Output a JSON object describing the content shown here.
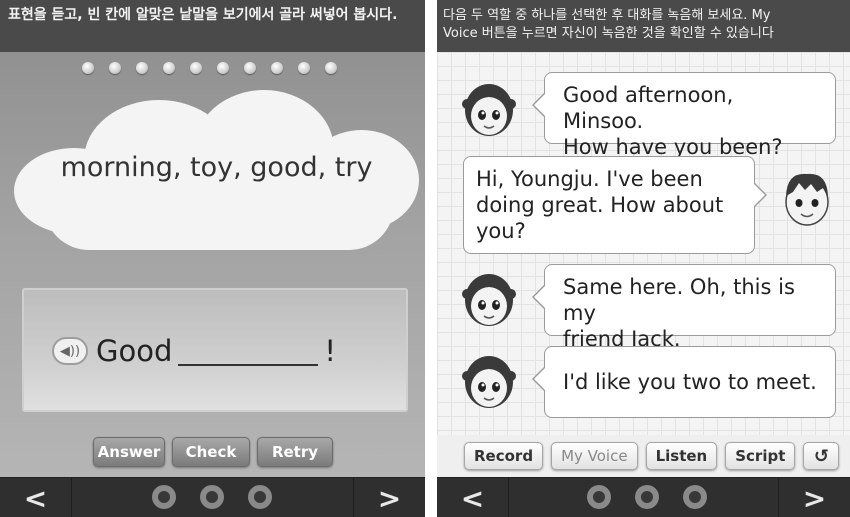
{
  "left": {
    "instruction": "표현을 듣고, 빈 칸에 알맞은 낱말을 보기에서 골라 써넣어 봅시다.",
    "progress_dots": 10,
    "word_bank": "morning, toy, good, try",
    "sentence": {
      "before": "Good",
      "after": "!"
    },
    "buttons": {
      "answer": "Answer",
      "check": "Check",
      "retry": "Retry"
    },
    "nav": {
      "prev": "<",
      "next": ">"
    }
  },
  "right": {
    "instruction_line1": "다음 두 역할 중 하나를 선택한 후 대화를 녹음해 보세요. My",
    "instruction_line2": "Voice 버튼을 누르면 자신이 녹음한 것을 확인할 수 있습니다",
    "dialog": [
      {
        "speaker": "girl",
        "line1": "Good afternoon, Minsoo.",
        "line2": "How have you been?",
        "line3": ""
      },
      {
        "speaker": "boy",
        "line1": "Hi, Youngju. I've been",
        "line2": "doing great. How about",
        "line3": "you?"
      },
      {
        "speaker": "girl",
        "line1": "Same here. Oh, this is my",
        "line2": "friend Jack.",
        "line3": ""
      },
      {
        "speaker": "girl",
        "line1": "I'd like you two to meet.",
        "line2": "",
        "line3": ""
      }
    ],
    "buttons": {
      "record": "Record",
      "my_voice": "My Voice",
      "listen": "Listen",
      "script": "Script",
      "reset_icon": "undo-icon"
    },
    "nav": {
      "prev": "<",
      "next": ">"
    }
  }
}
